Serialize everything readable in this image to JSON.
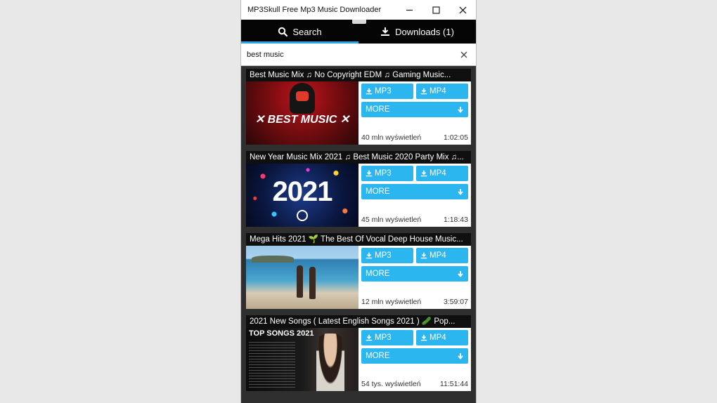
{
  "window": {
    "title": "MP3Skull Free Mp3 Music Downloader",
    "controls": {
      "minimize": "—",
      "maximize": "☐",
      "close": "✕"
    }
  },
  "tabs": [
    {
      "label": "Search",
      "icon": "search-icon",
      "active": true
    },
    {
      "label": "Downloads (1)",
      "icon": "download-icon",
      "active": false
    }
  ],
  "search": {
    "value": "best music",
    "clear": "✕"
  },
  "buttons": {
    "mp3": "MP3",
    "mp4": "MP4",
    "more": "MORE"
  },
  "results": [
    {
      "title": "Best Music Mix ♫ No Copyright EDM ♫ Gaming Music...",
      "views": "40 mln wyświetleń",
      "duration": "1:02:05",
      "thumb_text": "✕ BEST MUSIC ✕"
    },
    {
      "title": "New Year Music Mix 2021 ♫ Best Music 2020 Party Mix ♫...",
      "views": "45 mln wyświetleń",
      "duration": "1:18:43",
      "thumb_text": "2021"
    },
    {
      "title": "Mega Hits 2021 🌱 The Best Of Vocal Deep House Music...",
      "views": "12 mln wyświetleń",
      "duration": "3:59:07",
      "thumb_text": ""
    },
    {
      "title": "2021 New Songs ( Latest English Songs 2021 ) 🥒 Pop...",
      "views": "54 tys. wyświetleń",
      "duration": "11:51:44",
      "thumb_text": "TOP SONGS 2021"
    }
  ],
  "colors": {
    "accent": "#2bb6ef",
    "tab_bar": "#050505",
    "background": "#2f2f2f"
  }
}
